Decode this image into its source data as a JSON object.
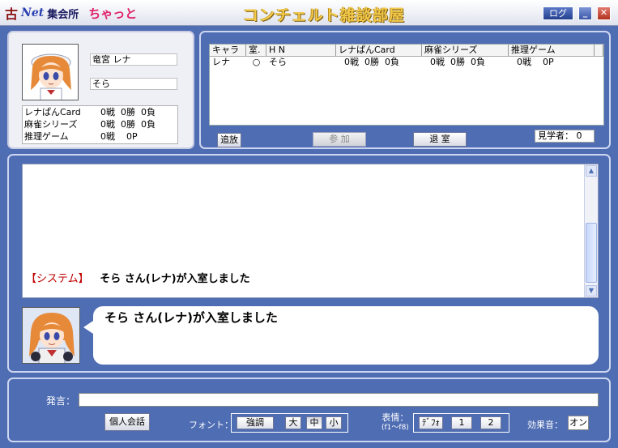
{
  "titlebar": {
    "logo_kanji": "古",
    "logo_net": "Net",
    "logo_text": "集会所",
    "logo_chat": "ちゃっと",
    "title": "コンチェルト雑談部屋",
    "log_label": "ログ",
    "minimize_label": "_",
    "close_label": "✕"
  },
  "profile": {
    "character_name": "竜宮 レナ",
    "handle": "そら",
    "stats": [
      {
        "label": "レナぱんCard",
        "value": "0戦  0勝  0負"
      },
      {
        "label": "麻雀シリーズ",
        "value": "0戦  0勝  0負"
      },
      {
        "label": "推理ゲーム",
        "value": "0戦    0P"
      }
    ]
  },
  "room": {
    "columns": [
      "キャラ",
      "室.",
      "H N",
      "レナぱんCard",
      "麻雀シリーズ",
      "推理ゲーム",
      ""
    ],
    "rows": [
      [
        "レナ",
        "○",
        "そら",
        "  0戦  0勝  0負",
        "  0戦  0勝  0負",
        "  0戦    0P",
        ""
      ]
    ],
    "kick_label": "追放",
    "join_label": "参 加",
    "leave_label": "退 室",
    "spectators": "見学者： 0"
  },
  "chat": {
    "system_tag": "【システム】",
    "log_message": "   そら さん(レナ)が入室しました",
    "bubble_message": "そら さん(レナ)が入室しました",
    "scroll_up": "▲",
    "scroll_down": "▼"
  },
  "input": {
    "say_label": "発言：",
    "say_value": "",
    "private_label": "個人会話",
    "font_label": "フォント：",
    "emphasis_label": "強調",
    "size_large": "大",
    "size_medium": "中",
    "size_small": "小",
    "face_label": "表情：",
    "face_sub": "(f1～f8)",
    "face_default": "ﾃﾞﾌｫ",
    "face_1": "1",
    "face_2": "2",
    "sound_label": "効果音：",
    "sound_value": "オン"
  },
  "colors": {
    "background": "#4f6db3",
    "title_gold": "#f2c94a",
    "system_red": "#c00000"
  }
}
